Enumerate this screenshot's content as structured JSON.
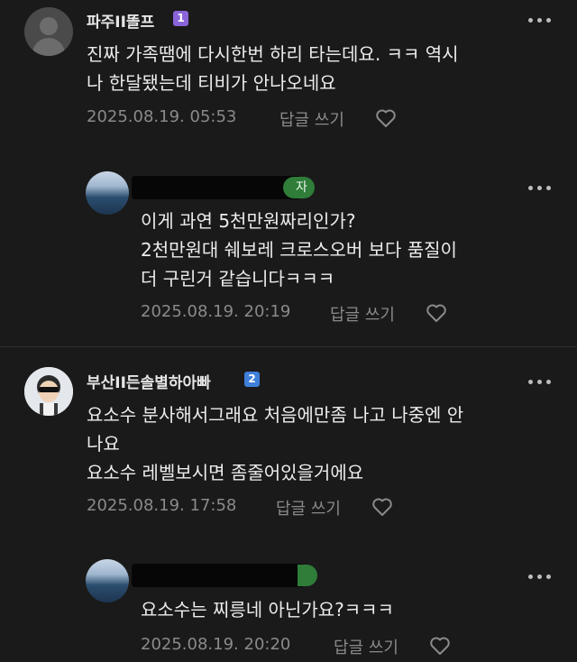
{
  "comments": [
    {
      "nickname": "파주II똘프",
      "level": "1",
      "lines": [
        "진짜 가족땜에 다시한번 하리 타는데요. ㅋㅋ 역시",
        "나 한달됐는데 티비가 안나오네요"
      ],
      "timestamp": "2025.08.19. 05:53",
      "reply_label": "답글 쓰기"
    },
    {
      "author_badge": "자",
      "lines": [
        "이게 과연 5천만원짜리인가?",
        "2천만원대 쉐보레 크로스오버 보다 품질이",
        "더 구린거 같습니다ㅋㅋㅋ"
      ],
      "timestamp": "2025.08.19. 20:19",
      "reply_label": "답글 쓰기"
    },
    {
      "nickname": "부산II든솔별하아빠",
      "level": "2",
      "lines": [
        "요소수 분사해서그래요 처음에만좀 나고 나중엔 안",
        "나요",
        "요소수 레벨보시면 좀줄어있을거에요"
      ],
      "timestamp": "2025.08.19. 17:58",
      "reply_label": "답글 쓰기"
    },
    {
      "lines": [
        "요소수는 찌릉네 아닌가요?ㅋㅋㅋ"
      ],
      "timestamp": "2025.08.19. 20:20",
      "reply_label": "답글 쓰기"
    }
  ]
}
